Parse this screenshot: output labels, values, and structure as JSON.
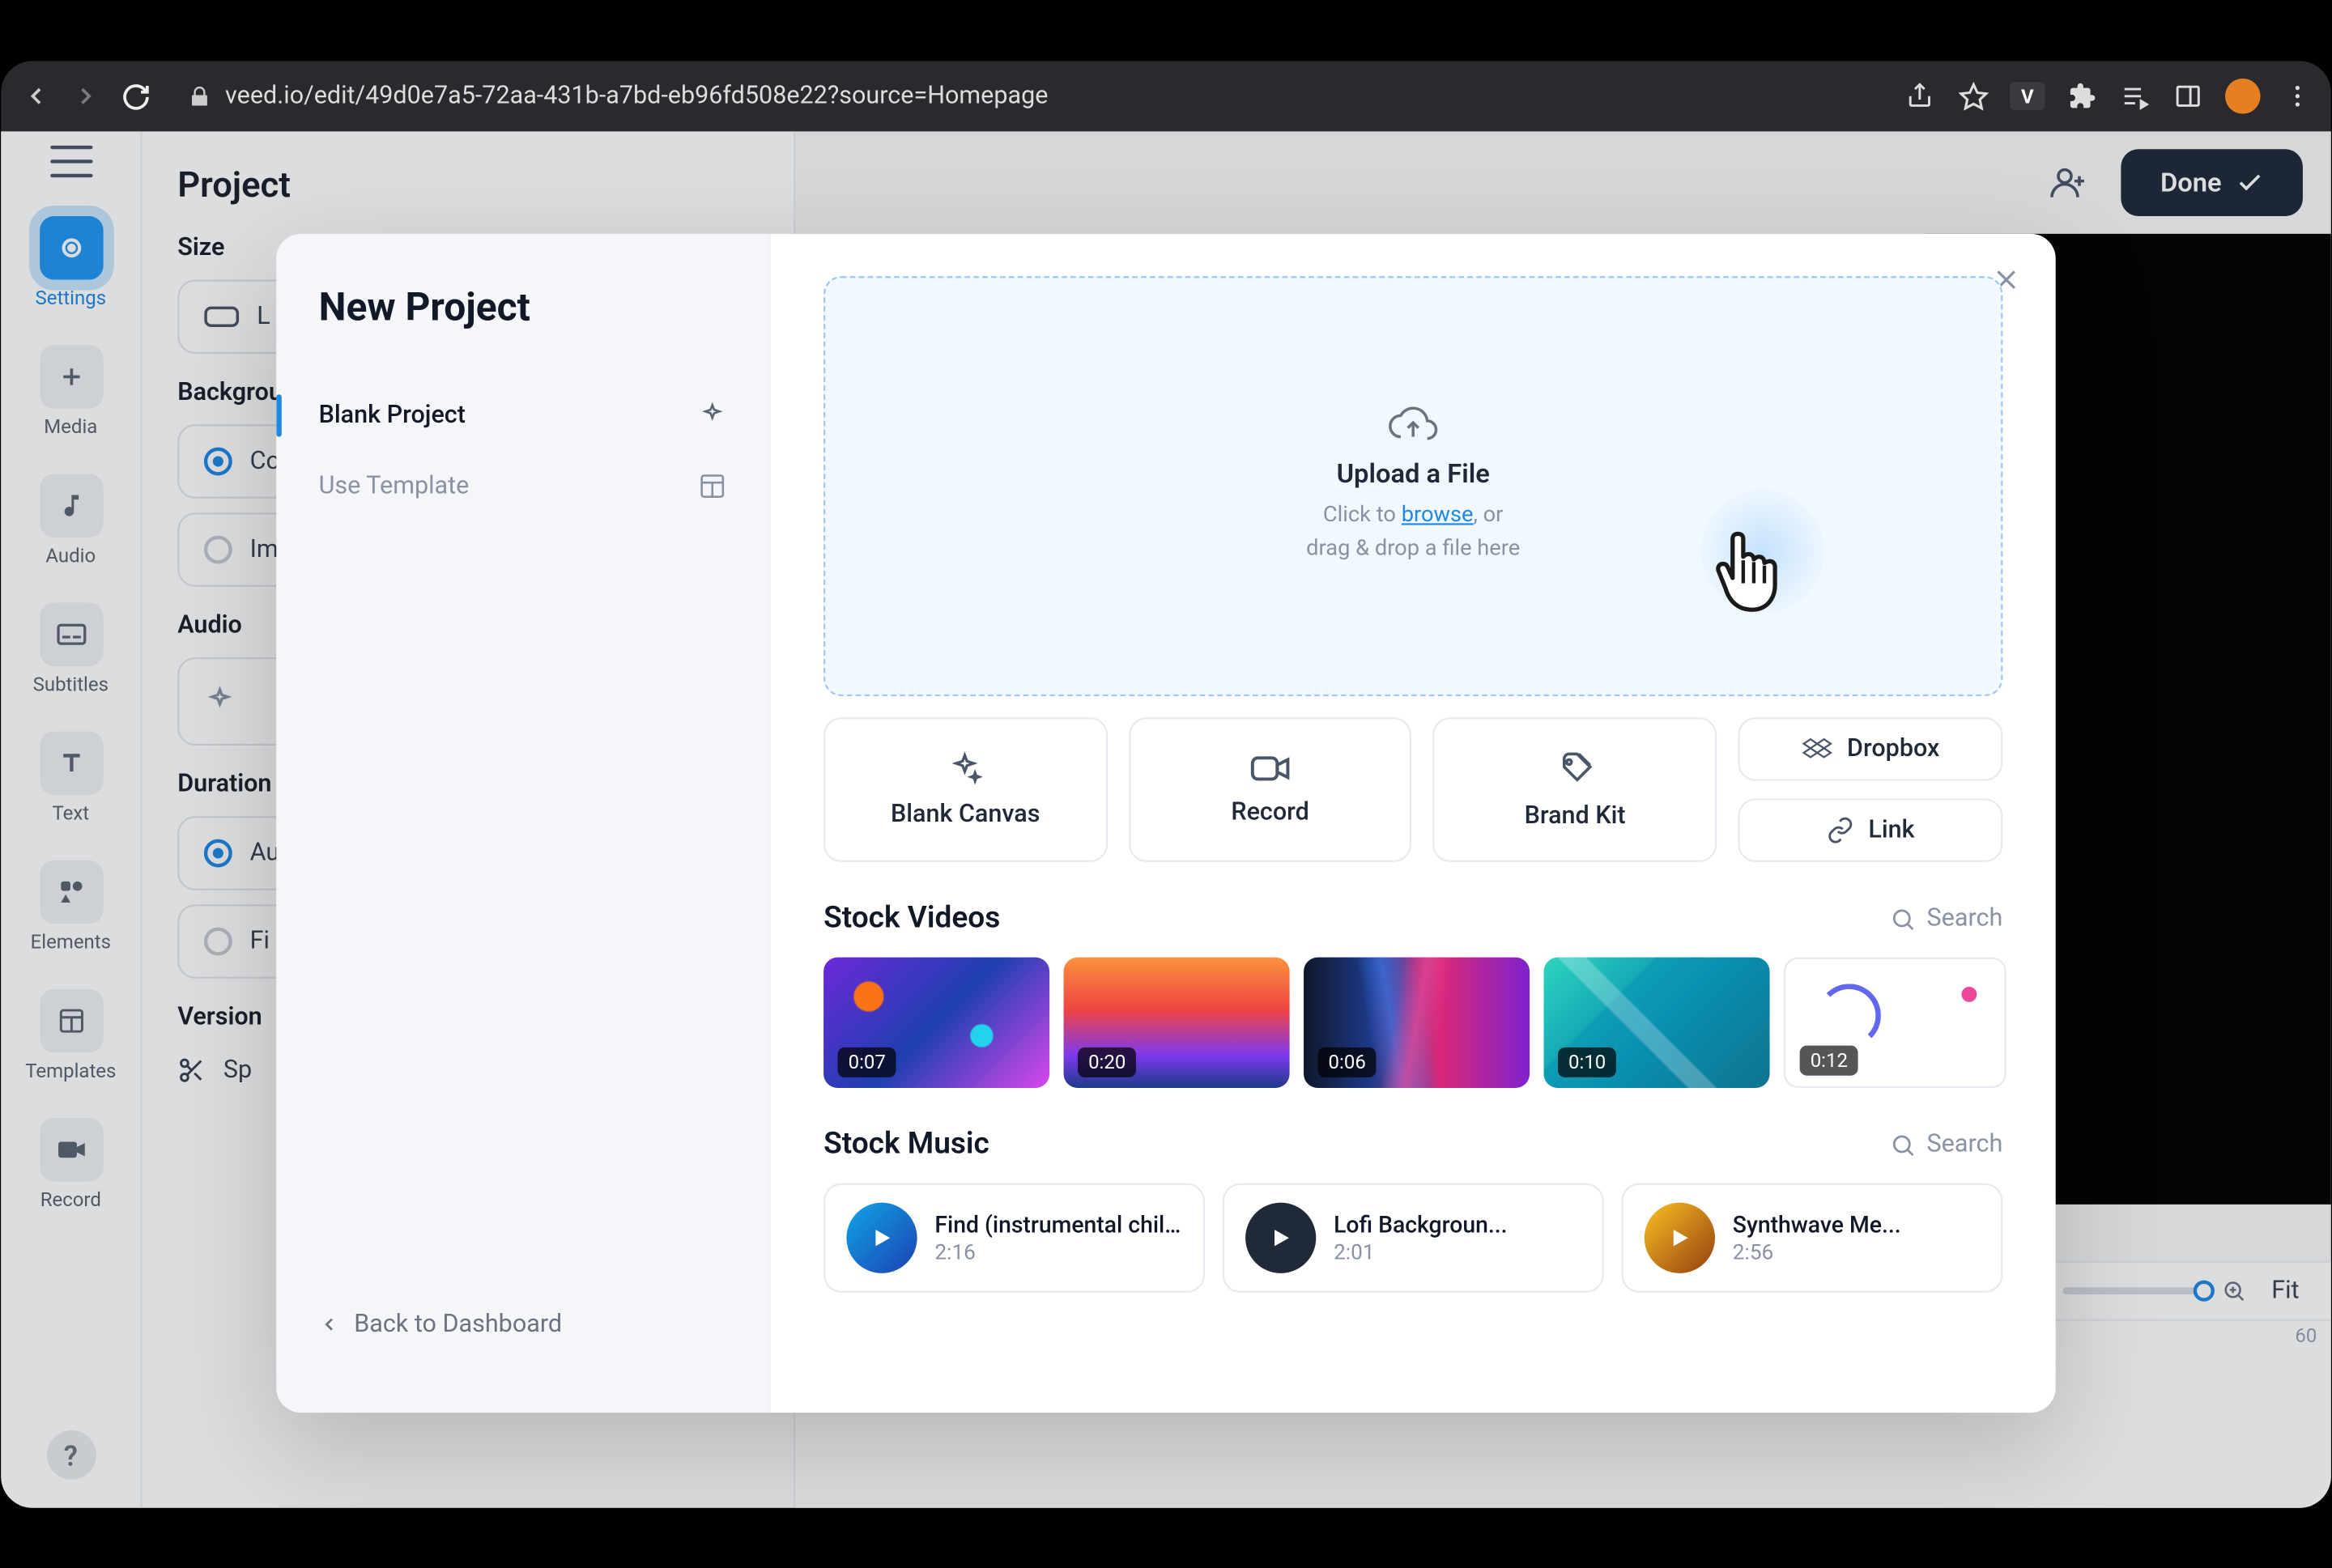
{
  "browser": {
    "url": "veed.io/edit/49d0e7a5-72aa-431b-a7bd-eb96fd508e22?source=Homepage",
    "v_ext": "V"
  },
  "rail": {
    "items": [
      {
        "label": "Settings",
        "active": true
      },
      {
        "label": "Media"
      },
      {
        "label": "Audio"
      },
      {
        "label": "Subtitles"
      },
      {
        "label": "Text"
      },
      {
        "label": "Elements"
      },
      {
        "label": "Templates"
      },
      {
        "label": "Record"
      }
    ]
  },
  "settings_panel": {
    "heading": "Project",
    "size_label": "Size",
    "size_value": "L",
    "bg_label": "Background",
    "bg_opts": [
      "Co",
      "Im"
    ],
    "audio_label": "Audio",
    "duration_label": "Duration",
    "dur_opts": [
      "Au",
      "Fi"
    ],
    "version_label": "Version",
    "split_label": "Sp"
  },
  "topbar": {
    "done": "Done"
  },
  "timeline": {
    "fit": "Fit",
    "end_tick": "60"
  },
  "modal": {
    "title": "New Project",
    "opts": {
      "blank": "Blank Project",
      "template": "Use Template"
    },
    "back": "Back to Dashboard",
    "upload": {
      "title": "Upload a File",
      "sub_prefix": "Click to ",
      "browse": "browse",
      "sub_suffix": ", or",
      "sub_line2": "drag & drop a file here"
    },
    "cards": {
      "blank": "Blank Canvas",
      "record": "Record",
      "brand": "Brand Kit",
      "dropbox": "Dropbox",
      "link": "Link"
    },
    "stock_videos": {
      "title": "Stock Videos",
      "search": "Search",
      "items": [
        {
          "duration": "0:07"
        },
        {
          "duration": "0:20"
        },
        {
          "duration": "0:06"
        },
        {
          "duration": "0:10"
        },
        {
          "duration": "0:12"
        }
      ]
    },
    "stock_music": {
      "title": "Stock Music",
      "search": "Search",
      "items": [
        {
          "title": "Find (instrumental chill lo",
          "duration": "2:16"
        },
        {
          "title": "Lofi Backgroun...",
          "duration": "2:01"
        },
        {
          "title": "Synthwave Me...",
          "duration": "2:56"
        }
      ]
    }
  }
}
